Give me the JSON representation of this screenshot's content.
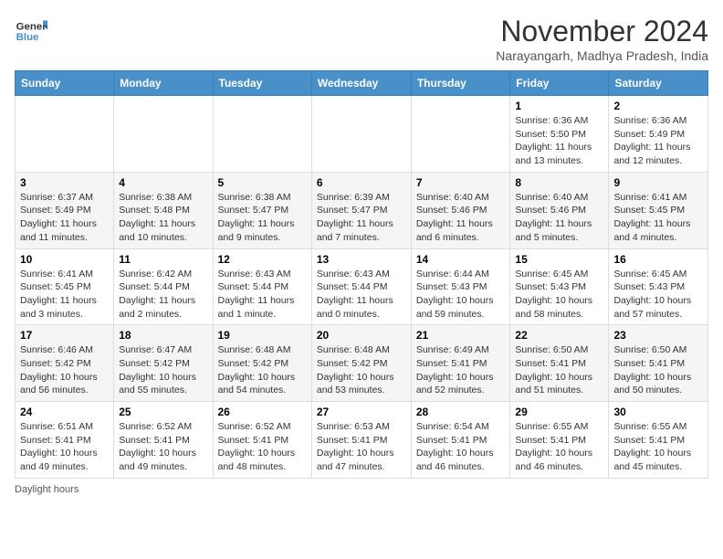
{
  "header": {
    "logo_line1": "General",
    "logo_line2": "Blue",
    "month_title": "November 2024",
    "subtitle": "Narayangarh, Madhya Pradesh, India"
  },
  "weekdays": [
    "Sunday",
    "Monday",
    "Tuesday",
    "Wednesday",
    "Thursday",
    "Friday",
    "Saturday"
  ],
  "weeks": [
    [
      {
        "day": "",
        "info": ""
      },
      {
        "day": "",
        "info": ""
      },
      {
        "day": "",
        "info": ""
      },
      {
        "day": "",
        "info": ""
      },
      {
        "day": "",
        "info": ""
      },
      {
        "day": "1",
        "info": "Sunrise: 6:36 AM\nSunset: 5:50 PM\nDaylight: 11 hours and 13 minutes."
      },
      {
        "day": "2",
        "info": "Sunrise: 6:36 AM\nSunset: 5:49 PM\nDaylight: 11 hours and 12 minutes."
      }
    ],
    [
      {
        "day": "3",
        "info": "Sunrise: 6:37 AM\nSunset: 5:49 PM\nDaylight: 11 hours and 11 minutes."
      },
      {
        "day": "4",
        "info": "Sunrise: 6:38 AM\nSunset: 5:48 PM\nDaylight: 11 hours and 10 minutes."
      },
      {
        "day": "5",
        "info": "Sunrise: 6:38 AM\nSunset: 5:47 PM\nDaylight: 11 hours and 9 minutes."
      },
      {
        "day": "6",
        "info": "Sunrise: 6:39 AM\nSunset: 5:47 PM\nDaylight: 11 hours and 7 minutes."
      },
      {
        "day": "7",
        "info": "Sunrise: 6:40 AM\nSunset: 5:46 PM\nDaylight: 11 hours and 6 minutes."
      },
      {
        "day": "8",
        "info": "Sunrise: 6:40 AM\nSunset: 5:46 PM\nDaylight: 11 hours and 5 minutes."
      },
      {
        "day": "9",
        "info": "Sunrise: 6:41 AM\nSunset: 5:45 PM\nDaylight: 11 hours and 4 minutes."
      }
    ],
    [
      {
        "day": "10",
        "info": "Sunrise: 6:41 AM\nSunset: 5:45 PM\nDaylight: 11 hours and 3 minutes."
      },
      {
        "day": "11",
        "info": "Sunrise: 6:42 AM\nSunset: 5:44 PM\nDaylight: 11 hours and 2 minutes."
      },
      {
        "day": "12",
        "info": "Sunrise: 6:43 AM\nSunset: 5:44 PM\nDaylight: 11 hours and 1 minute."
      },
      {
        "day": "13",
        "info": "Sunrise: 6:43 AM\nSunset: 5:44 PM\nDaylight: 11 hours and 0 minutes."
      },
      {
        "day": "14",
        "info": "Sunrise: 6:44 AM\nSunset: 5:43 PM\nDaylight: 10 hours and 59 minutes."
      },
      {
        "day": "15",
        "info": "Sunrise: 6:45 AM\nSunset: 5:43 PM\nDaylight: 10 hours and 58 minutes."
      },
      {
        "day": "16",
        "info": "Sunrise: 6:45 AM\nSunset: 5:43 PM\nDaylight: 10 hours and 57 minutes."
      }
    ],
    [
      {
        "day": "17",
        "info": "Sunrise: 6:46 AM\nSunset: 5:42 PM\nDaylight: 10 hours and 56 minutes."
      },
      {
        "day": "18",
        "info": "Sunrise: 6:47 AM\nSunset: 5:42 PM\nDaylight: 10 hours and 55 minutes."
      },
      {
        "day": "19",
        "info": "Sunrise: 6:48 AM\nSunset: 5:42 PM\nDaylight: 10 hours and 54 minutes."
      },
      {
        "day": "20",
        "info": "Sunrise: 6:48 AM\nSunset: 5:42 PM\nDaylight: 10 hours and 53 minutes."
      },
      {
        "day": "21",
        "info": "Sunrise: 6:49 AM\nSunset: 5:41 PM\nDaylight: 10 hours and 52 minutes."
      },
      {
        "day": "22",
        "info": "Sunrise: 6:50 AM\nSunset: 5:41 PM\nDaylight: 10 hours and 51 minutes."
      },
      {
        "day": "23",
        "info": "Sunrise: 6:50 AM\nSunset: 5:41 PM\nDaylight: 10 hours and 50 minutes."
      }
    ],
    [
      {
        "day": "24",
        "info": "Sunrise: 6:51 AM\nSunset: 5:41 PM\nDaylight: 10 hours and 49 minutes."
      },
      {
        "day": "25",
        "info": "Sunrise: 6:52 AM\nSunset: 5:41 PM\nDaylight: 10 hours and 49 minutes."
      },
      {
        "day": "26",
        "info": "Sunrise: 6:52 AM\nSunset: 5:41 PM\nDaylight: 10 hours and 48 minutes."
      },
      {
        "day": "27",
        "info": "Sunrise: 6:53 AM\nSunset: 5:41 PM\nDaylight: 10 hours and 47 minutes."
      },
      {
        "day": "28",
        "info": "Sunrise: 6:54 AM\nSunset: 5:41 PM\nDaylight: 10 hours and 46 minutes."
      },
      {
        "day": "29",
        "info": "Sunrise: 6:55 AM\nSunset: 5:41 PM\nDaylight: 10 hours and 46 minutes."
      },
      {
        "day": "30",
        "info": "Sunrise: 6:55 AM\nSunset: 5:41 PM\nDaylight: 10 hours and 45 minutes."
      }
    ]
  ],
  "footer": {
    "daylight_label": "Daylight hours"
  }
}
